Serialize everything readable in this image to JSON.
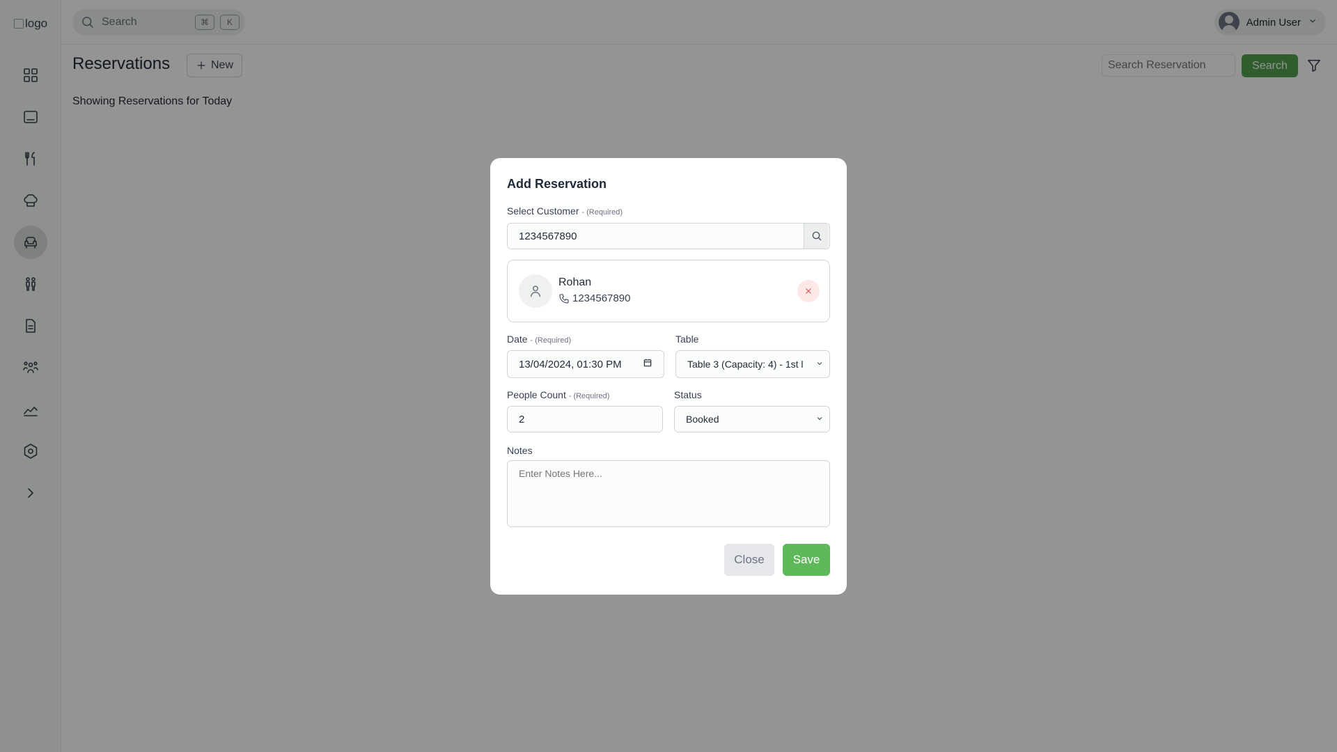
{
  "app": {
    "logo_alt": "logo",
    "global_search_placeholder": "Search",
    "kbd_cmd": "⌘",
    "kbd_k": "K",
    "user_name": "Admin User"
  },
  "sidebar": {
    "items": [
      {
        "icon": "dashboard-icon",
        "active": false
      },
      {
        "icon": "pos-terminal-icon",
        "active": false
      },
      {
        "icon": "utensils-icon",
        "active": false
      },
      {
        "icon": "chef-hat-icon",
        "active": false
      },
      {
        "icon": "armchair-icon",
        "active": true
      },
      {
        "icon": "people-icon",
        "active": false
      },
      {
        "icon": "document-icon",
        "active": false
      },
      {
        "icon": "team-icon",
        "active": false
      },
      {
        "icon": "chart-icon",
        "active": false
      },
      {
        "icon": "settings-icon",
        "active": false
      },
      {
        "icon": "chevron-right-icon",
        "active": false
      }
    ]
  },
  "page": {
    "title": "Reservations",
    "new_label": "New",
    "search_placeholder": "Search Reservation",
    "search_button": "Search",
    "subtitle": "Showing Reservations for Today"
  },
  "modal": {
    "title": "Add Reservation",
    "customer_label": "Select Customer",
    "required_suffix": "- (Required)",
    "customer_search_value": "1234567890",
    "customer": {
      "name": "Rohan",
      "phone": "1234567890"
    },
    "date_label": "Date",
    "date_value": "13/04/2024, 01:30 PM",
    "table_label": "Table",
    "table_value": "Table 3 (Capacity: 4) - 1st l",
    "people_label": "People Count",
    "people_value": "2",
    "status_label": "Status",
    "status_value": "Booked",
    "notes_label": "Notes",
    "notes_placeholder": "Enter Notes Here...",
    "close_label": "Close",
    "save_label": "Save"
  },
  "colors": {
    "accent": "#4ea24a",
    "save": "#5fb85a",
    "danger": "#ef4444"
  }
}
